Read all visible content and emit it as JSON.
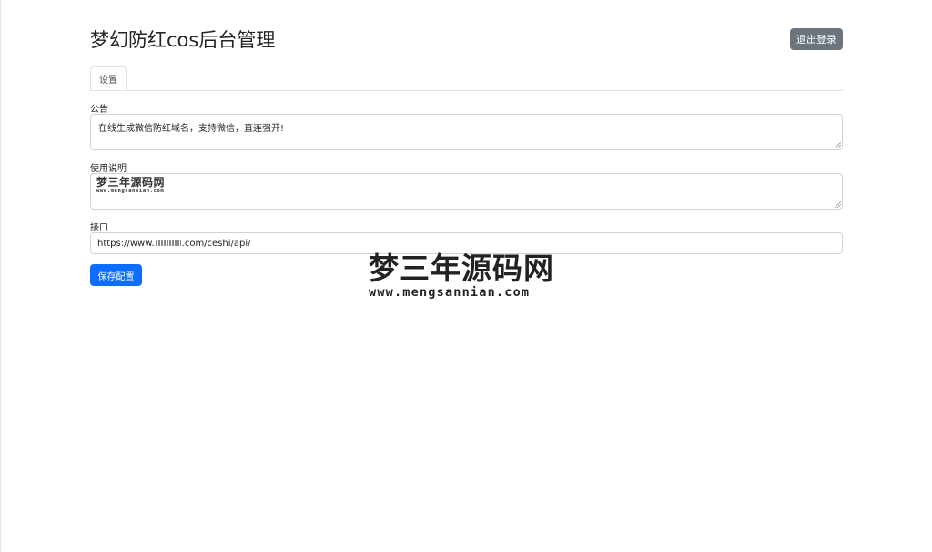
{
  "header": {
    "title": "梦幻防红cos后台管理",
    "logout_label": "退出登录"
  },
  "tabs": [
    {
      "label": "设置"
    }
  ],
  "form": {
    "notice": {
      "label": "公告",
      "value": "在线生成微信防红域名，支持微信，直连强开!"
    },
    "instructions": {
      "label": "使用说明",
      "logo_cn": "梦三年源码网",
      "logo_en": "www.mengsannian.com"
    },
    "api": {
      "label": "接口",
      "value_prefix": "https://www.",
      "value_suffix": ".com/ceshi/api/"
    },
    "save_label": "保存配置"
  },
  "watermark": {
    "cn": "梦三年源码网",
    "en": "www.mengsannian.com"
  }
}
